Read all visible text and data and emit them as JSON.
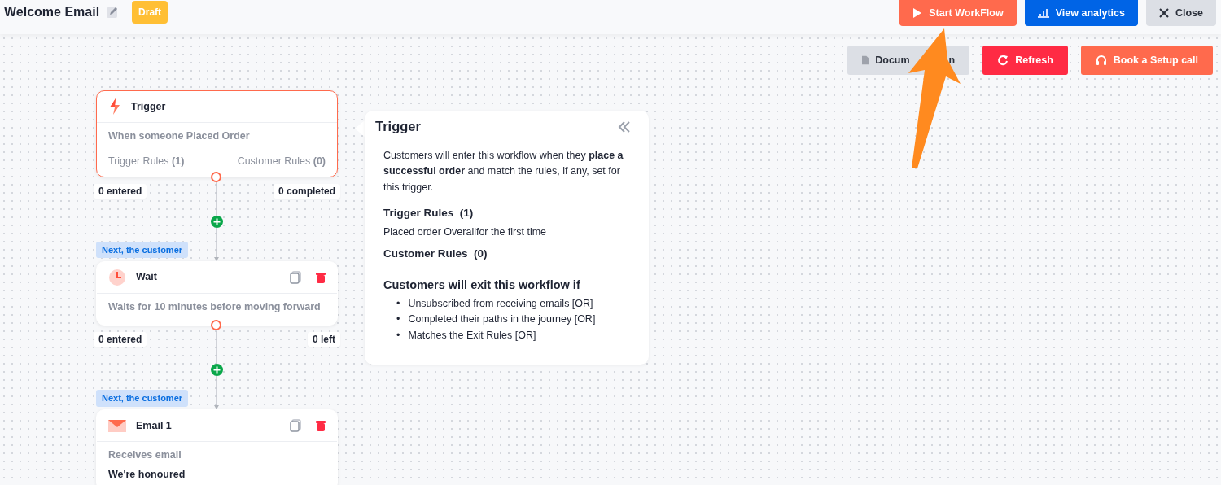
{
  "header": {
    "title": "Welcome Email",
    "status": "Draft",
    "actions": [
      {
        "label": "Start WorkFlow",
        "kind": "play"
      },
      {
        "label": "View analytics",
        "kind": "chart"
      },
      {
        "label": "Close",
        "kind": "close"
      }
    ]
  },
  "toolbar": [
    {
      "label_parts": [
        "Docum",
        "n"
      ],
      "kind": "doc"
    },
    {
      "label": "Refresh",
      "kind": "refresh"
    },
    {
      "label": "Book a Setup call",
      "kind": "headset"
    }
  ],
  "nodes": [
    {
      "kind": "trigger",
      "title": "Trigger",
      "selected": true,
      "description": "When someone **Placed Order**",
      "rules": [
        "Trigger Rules **(1)**",
        "Customer Rules **(0)**"
      ],
      "stats": [
        "0 entered",
        "0 completed"
      ]
    },
    {
      "kind": "wait",
      "tag": "Next, the customer",
      "title": "Wait",
      "selected": false,
      "description": "Waits for **10 minutes** before moving forward",
      "stats": [
        "0 entered",
        "0 left"
      ]
    },
    {
      "kind": "email",
      "tag": "Next, the customer",
      "title": "Email 1",
      "selected": false,
      "subtitle": "Receives email",
      "description": "We're honoured"
    }
  ],
  "panel": {
    "title": "Trigger",
    "intro": "Customers will enter this workflow when they **place a successful order** and match the rules, if any, set for this trigger.",
    "sections": [
      {
        "heading": "Trigger Rules  (1)",
        "text": "Placed order Overallfor the first time"
      },
      {
        "heading": "Customer Rules  (0)"
      }
    ],
    "exit_heading": "Customers will exit this workflow if",
    "marker": "•",
    "exit_items": [
      "Unsubscribed from receiving emails [OR]",
      "Completed their paths in the journey [OR]",
      "Matches the Exit Rules [OR]"
    ]
  }
}
